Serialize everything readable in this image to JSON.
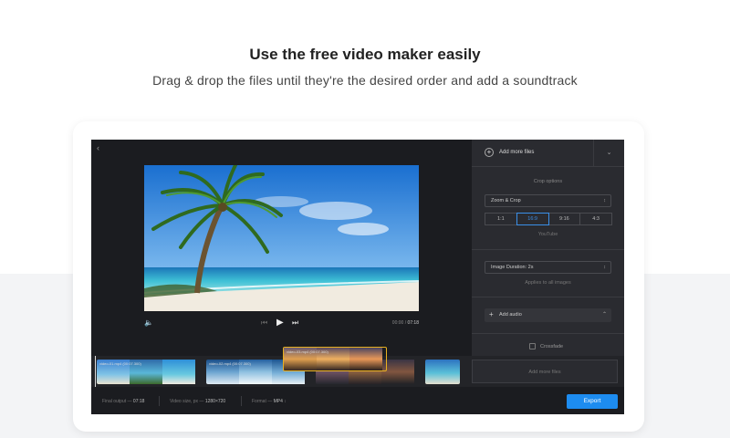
{
  "page": {
    "heading": "Use the free video maker easily",
    "subheading": "Drag & drop the files until they're the desired order and add a soundtrack"
  },
  "editor": {
    "back_icon": "chevron-left-icon",
    "player": {
      "time_current": "00:00",
      "time_total": "07:18",
      "time_separator": "/"
    },
    "panel": {
      "add_files_label": "Add more files",
      "crop_options_title": "Crop options",
      "crop_mode": "Zoom & Crop",
      "ratios": [
        "1:1",
        "16:9",
        "9:16",
        "4:3"
      ],
      "active_ratio": "16:9",
      "platform_label": "YouTube",
      "image_duration": "Image Duration: 2s",
      "applies_note": "Applies to all images",
      "add_audio_label": "Add audio",
      "crossfade_label": "Crossfade"
    },
    "timeline": {
      "clips": [
        {
          "name": "video-01.mp4 (00:07.300)"
        },
        {
          "name": "video-02.mp4 (00:07.300)"
        },
        {
          "name": "video-03.mp4 (00:07.300)"
        }
      ],
      "add_more_label": "Add more files"
    },
    "status": {
      "final_output_label": "Final output —",
      "final_output_value": "07:18",
      "video_size_label": "Video size, px —",
      "video_size_value": "1280×720",
      "format_label": "Format —",
      "format_value": "MP4",
      "export_label": "Export"
    }
  },
  "colors": {
    "accent": "#1d8cf0",
    "selected_clip": "#e8b020",
    "editor_bg": "#1b1c20",
    "panel_bg": "#2a2b30"
  }
}
